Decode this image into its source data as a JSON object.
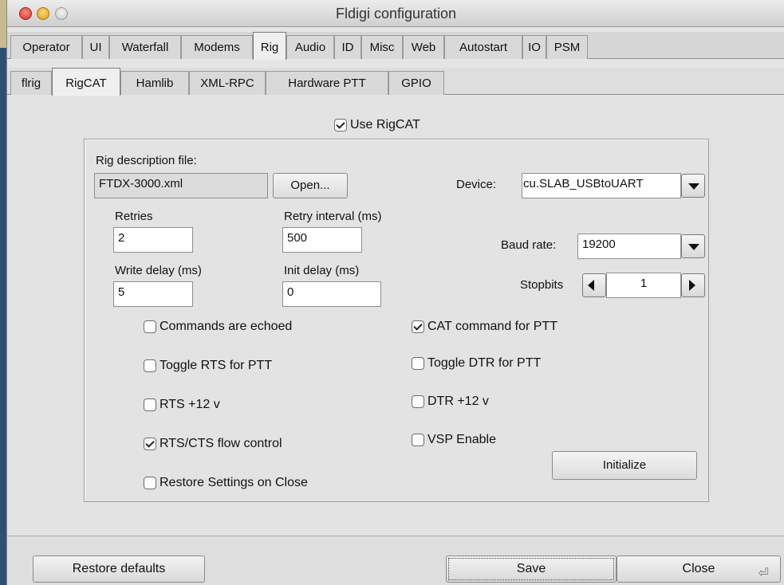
{
  "window": {
    "title": "Fldigi configuration"
  },
  "tabs_main": [
    {
      "label": "Operator"
    },
    {
      "label": "UI"
    },
    {
      "label": "Waterfall"
    },
    {
      "label": "Modems"
    },
    {
      "label": "Rig"
    },
    {
      "label": "Audio"
    },
    {
      "label": "ID"
    },
    {
      "label": "Misc"
    },
    {
      "label": "Web"
    },
    {
      "label": "Autostart"
    },
    {
      "label": "IO"
    },
    {
      "label": "PSM"
    }
  ],
  "tabs_rig": [
    {
      "label": "flrig"
    },
    {
      "label": "RigCAT"
    },
    {
      "label": "Hamlib"
    },
    {
      "label": "XML-RPC"
    },
    {
      "label": "Hardware PTT"
    },
    {
      "label": "GPIO"
    }
  ],
  "rigcat": {
    "use_label": "Use RigCAT",
    "use_checked": true,
    "rig_desc_label": "Rig description file:",
    "rig_desc_value": "FTDX-3000.xml",
    "open_label": "Open...",
    "device_label": "Device:",
    "device_value": "cu.SLAB_USBtoUART",
    "retries_label": "Retries",
    "retries_value": "2",
    "retry_interval_label": "Retry interval (ms)",
    "retry_interval_value": "500",
    "baud_label": "Baud rate:",
    "baud_value": "19200",
    "write_delay_label": "Write delay (ms)",
    "write_delay_value": "5",
    "init_delay_label": "Init delay (ms)",
    "init_delay_value": "0",
    "stopbits_label": "Stopbits",
    "stopbits_value": "1",
    "checks": {
      "commands_echoed": {
        "label": "Commands are echoed",
        "checked": false
      },
      "cat_ptt": {
        "label": "CAT command for PTT",
        "checked": true
      },
      "toggle_rts": {
        "label": "Toggle RTS for PTT",
        "checked": false
      },
      "toggle_dtr": {
        "label": "Toggle DTR for PTT",
        "checked": false
      },
      "rts12": {
        "label": "RTS +12 v",
        "checked": false
      },
      "dtr12": {
        "label": "DTR +12 v",
        "checked": false
      },
      "rtscts": {
        "label": "RTS/CTS flow control",
        "checked": true
      },
      "vsp": {
        "label": "VSP Enable",
        "checked": false
      },
      "restore_on_close": {
        "label": "Restore Settings on Close",
        "checked": false
      }
    },
    "initialize_label": "Initialize"
  },
  "footer": {
    "restore_defaults": "Restore defaults",
    "save": "Save",
    "close": "Close"
  },
  "icons": {
    "close_window": "close-window-icon",
    "minimize_window": "minimize-window-icon",
    "zoom_window": "zoom-window-icon",
    "dropdown": "chevron-down-icon",
    "left": "arrow-left-icon",
    "right": "arrow-right-icon",
    "enter": "return-key-icon"
  }
}
